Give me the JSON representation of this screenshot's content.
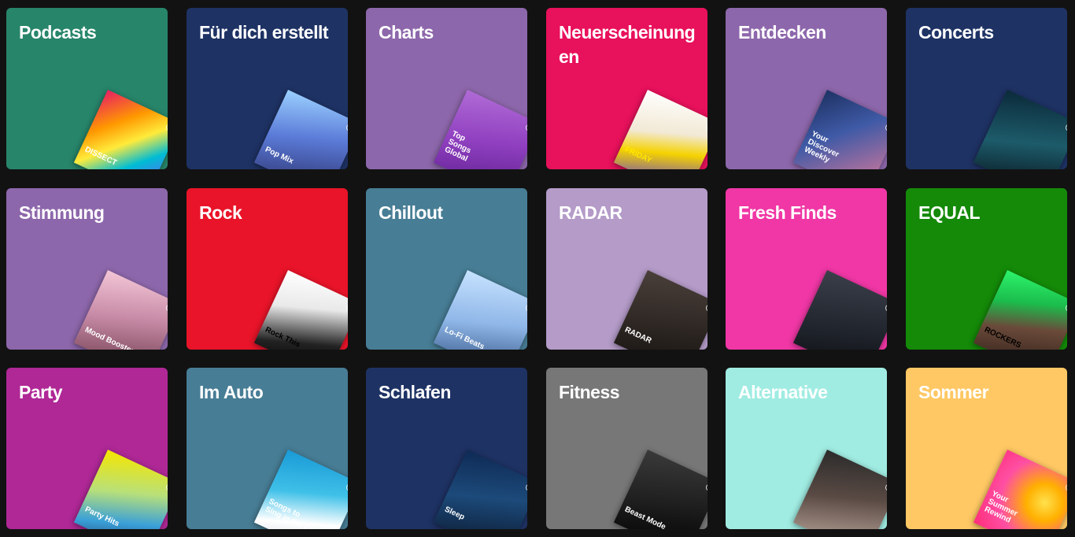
{
  "cards": [
    {
      "title": "Podcasts",
      "bg": "#27856a",
      "cover": {
        "art": "linear-gradient(135deg,#e91e63 0%,#ff9800 30%,#ffeb3b 50%,#00bcd4 70%,#7c4dff 100%)",
        "label": "DISSECT",
        "color": "#ffffff",
        "icon": "dissect-podcast-cover-icon"
      }
    },
    {
      "title": "Für dich erstellt",
      "bg": "#1e3264",
      "cover": {
        "art": "linear-gradient(160deg,#9bd0ff 0%,#5b7bd8 45%,#2b2f6a 100%)",
        "label": "Pop Mix",
        "color": "#ffffff",
        "icon": "pop-mix-cover-icon"
      }
    },
    {
      "title": "Charts",
      "bg": "#8d67ab",
      "cover": {
        "art": "linear-gradient(160deg,#b06bd6 0%,#8f3fbf 50%,#5e1f8f 100%)",
        "label": "Top\nSongs\nGlobal",
        "color": "#ffffff",
        "icon": "top-songs-global-cover-icon"
      }
    },
    {
      "title": "Neuerscheinungen",
      "bg": "#e8115b",
      "cover": {
        "art": "linear-gradient(160deg,#ffffff 0%,#f2e9d5 40%,#f5d200 60%,#3a1cff 100%)",
        "label": "FRIDAY",
        "color": "#ffe600",
        "icon": "new-music-friday-cover-icon"
      }
    },
    {
      "title": "Entdecken",
      "bg": "#8d67ab",
      "cover": {
        "art": "linear-gradient(135deg,#1e3264 0%,#3f5aa6 40%,#e07a9a 100%)",
        "label": "Your\nDiscover\nWeekly",
        "color": "#ffffff",
        "icon": "discover-weekly-cover-icon"
      }
    },
    {
      "title": "Concerts",
      "bg": "#1e3264",
      "cover": {
        "art": "linear-gradient(160deg,#0b2a3a 0%,#1d5b6a 50%,#061018 100%)",
        "label": "",
        "color": "#ffffff",
        "icon": "microphone-cover-icon"
      }
    },
    {
      "title": "Stimmung",
      "bg": "#8d67ab",
      "cover": {
        "art": "linear-gradient(160deg,#f3c6d6 0%,#c78aa6 45%,#6b3a4a 100%)",
        "label": "Mood Booster",
        "color": "#ffffff",
        "icon": "mood-booster-cover-icon"
      }
    },
    {
      "title": "Rock",
      "bg": "#e91429",
      "cover": {
        "art": "linear-gradient(160deg,#ffffff 0%,#e9e9e9 35%,#222222 70%,#000000 100%)",
        "label": "Rock This",
        "color": "#000000",
        "icon": "rock-this-cover-icon"
      }
    },
    {
      "title": "Chillout",
      "bg": "#477d95",
      "cover": {
        "art": "linear-gradient(160deg,#c7e2ff 0%,#8fb7e8 50%,#2f4f7f 100%)",
        "label": "Lo-Fi Beats",
        "color": "#ffffff",
        "icon": "lofi-beats-cover-icon"
      }
    },
    {
      "title": "RADAR",
      "bg": "#b49bc8",
      "cover": {
        "art": "linear-gradient(160deg,#4a3f3a 0%,#2a2420 60%,#14110f 100%)",
        "label": "RADAR",
        "color": "#ffffff",
        "icon": "radar-cover-icon"
      }
    },
    {
      "title": "Fresh Finds",
      "bg": "#f037a5",
      "cover": {
        "art": "linear-gradient(160deg,#3b3f4a 0%,#1f232b 60%,#0c0d10 100%)",
        "label": "",
        "color": "#ffffff",
        "icon": "fresh-finds-cover-icon"
      }
    },
    {
      "title": "EQUAL",
      "bg": "#148a08",
      "cover": {
        "art": "linear-gradient(160deg,#2df36b 0%,#1bbd4c 30%,#6a4a3a 55%,#2a1a14 100%)",
        "label": "ROCKERS",
        "color": "#000000",
        "icon": "equal-rockers-cover-icon"
      }
    },
    {
      "title": "Party",
      "bg": "#af2896",
      "cover": {
        "art": "linear-gradient(160deg,#f5e600 0%,#b8e07a 40%,#3aa0d8 70%,#1e3264 100%)",
        "label": "Party Hits",
        "color": "#ffffff",
        "icon": "party-hits-cover-icon"
      }
    },
    {
      "title": "Im Auto",
      "bg": "#477d95",
      "cover": {
        "art": "linear-gradient(160deg,#1a9ad6 0%,#3ec0e8 40%,#ffffff 70%,#c8d3da 100%)",
        "label": "Songs to\nSing in the Car",
        "color": "#ffffff",
        "icon": "songs-to-sing-cover-icon"
      }
    },
    {
      "title": "Schlafen",
      "bg": "#1e3264",
      "cover": {
        "art": "linear-gradient(160deg,#0f2a55 0%,#1c4a7a 45%,#0a1428 100%)",
        "label": "Sleep",
        "color": "#ffffff",
        "icon": "sleep-cover-icon"
      }
    },
    {
      "title": "Fitness",
      "bg": "#777777",
      "cover": {
        "art": "linear-gradient(160deg,#3a3a3a 0%,#1f1f1f 50%,#000000 100%)",
        "label": "Beast Mode",
        "color": "#ffffff",
        "icon": "beast-mode-cover-icon"
      }
    },
    {
      "title": "Alternative",
      "bg": "#a0ece2",
      "cover": {
        "art": "linear-gradient(160deg,#2b2b2b 0%,#5a4a44 45%,#c8b4a8 100%)",
        "label": "",
        "color": "#ffffff",
        "icon": "alternative-bolt-cover-icon"
      }
    },
    {
      "title": "Sommer",
      "bg": "#ffc864",
      "cover": {
        "art": "radial-gradient(circle at 70% 40%,#ffe14d 0%,#ffb000 25%,#ff4fa3 60%,#ff2d7a 100%)",
        "label": "Your\nSummer\nRewind",
        "color": "#ffffff",
        "icon": "summer-rewind-cover-icon"
      }
    }
  ]
}
